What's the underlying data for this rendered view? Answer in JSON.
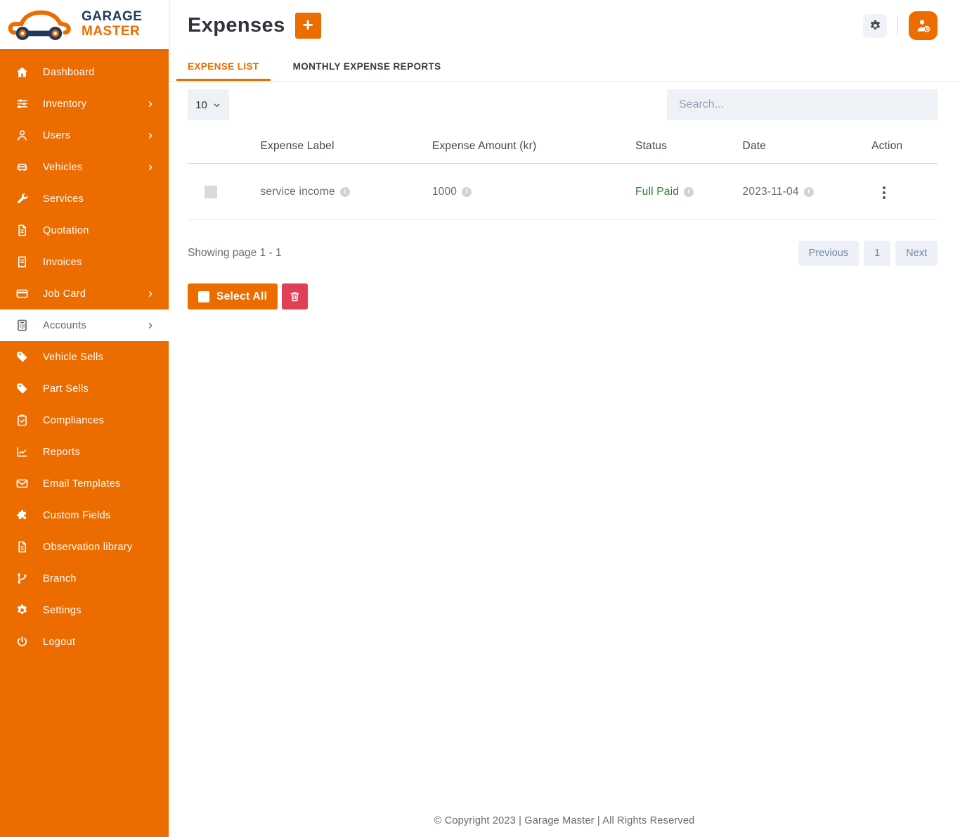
{
  "brand": {
    "garage": "GARAGE",
    "master": "MASTER"
  },
  "sidebar": {
    "items": [
      {
        "label": "Dashboard",
        "icon": "home-icon",
        "has_submenu": false,
        "active": false
      },
      {
        "label": "Inventory",
        "icon": "sliders-icon",
        "has_submenu": true,
        "active": false
      },
      {
        "label": "Users",
        "icon": "user-icon",
        "has_submenu": true,
        "active": false
      },
      {
        "label": "Vehicles",
        "icon": "car-icon",
        "has_submenu": true,
        "active": false
      },
      {
        "label": "Services",
        "icon": "wrench-icon",
        "has_submenu": false,
        "active": false
      },
      {
        "label": "Quotation",
        "icon": "file-invoice-icon",
        "has_submenu": false,
        "active": false
      },
      {
        "label": "Invoices",
        "icon": "receipt-icon",
        "has_submenu": false,
        "active": false
      },
      {
        "label": "Job Card",
        "icon": "credit-card-icon",
        "has_submenu": true,
        "active": false
      },
      {
        "label": "Accounts",
        "icon": "calculator-icon",
        "has_submenu": true,
        "active": true
      },
      {
        "label": "Vehicle Sells",
        "icon": "tag-icon",
        "has_submenu": false,
        "active": false
      },
      {
        "label": "Part Sells",
        "icon": "tag-icon",
        "has_submenu": false,
        "active": false
      },
      {
        "label": "Compliances",
        "icon": "clipboard-check-icon",
        "has_submenu": false,
        "active": false
      },
      {
        "label": "Reports",
        "icon": "chart-line-icon",
        "has_submenu": false,
        "active": false
      },
      {
        "label": "Email Templates",
        "icon": "envelope-icon",
        "has_submenu": false,
        "active": false
      },
      {
        "label": "Custom Fields",
        "icon": "puzzle-icon",
        "has_submenu": false,
        "active": false
      },
      {
        "label": "Observation library",
        "icon": "file-icon",
        "has_submenu": false,
        "active": false
      },
      {
        "label": "Branch",
        "icon": "code-branch-icon",
        "has_submenu": false,
        "active": false
      },
      {
        "label": "Settings",
        "icon": "gear-icon",
        "has_submenu": false,
        "active": false
      },
      {
        "label": "Logout",
        "icon": "power-icon",
        "has_submenu": false,
        "active": false
      }
    ]
  },
  "header": {
    "title": "Expenses",
    "add_label": "+"
  },
  "tabs": [
    {
      "label": "EXPENSE LIST",
      "active": true
    },
    {
      "label": "MONTHLY EXPENSE REPORTS",
      "active": false
    }
  ],
  "controls": {
    "per_page": "10",
    "search_placeholder": "Search..."
  },
  "table": {
    "columns": [
      "Expense Label",
      "Expense Amount (kr)",
      "Status",
      "Date",
      "Action"
    ],
    "rows": [
      {
        "label": "service income",
        "amount": "1000",
        "status": "Full Paid",
        "date": "2023-11-04"
      }
    ]
  },
  "pagination": {
    "summary": "Showing page 1 - 1",
    "previous": "Previous",
    "page": "1",
    "next": "Next"
  },
  "bulk": {
    "select_all_label": "Select All"
  },
  "footer": {
    "copyright": "© Copyright 2023 | Garage Master | All Rights Reserved"
  },
  "colors": {
    "accent": "#EC6C00",
    "brand_navy": "#1E3A5C",
    "status_paid_green": "#2E7D32",
    "delete_red": "#E04055"
  }
}
